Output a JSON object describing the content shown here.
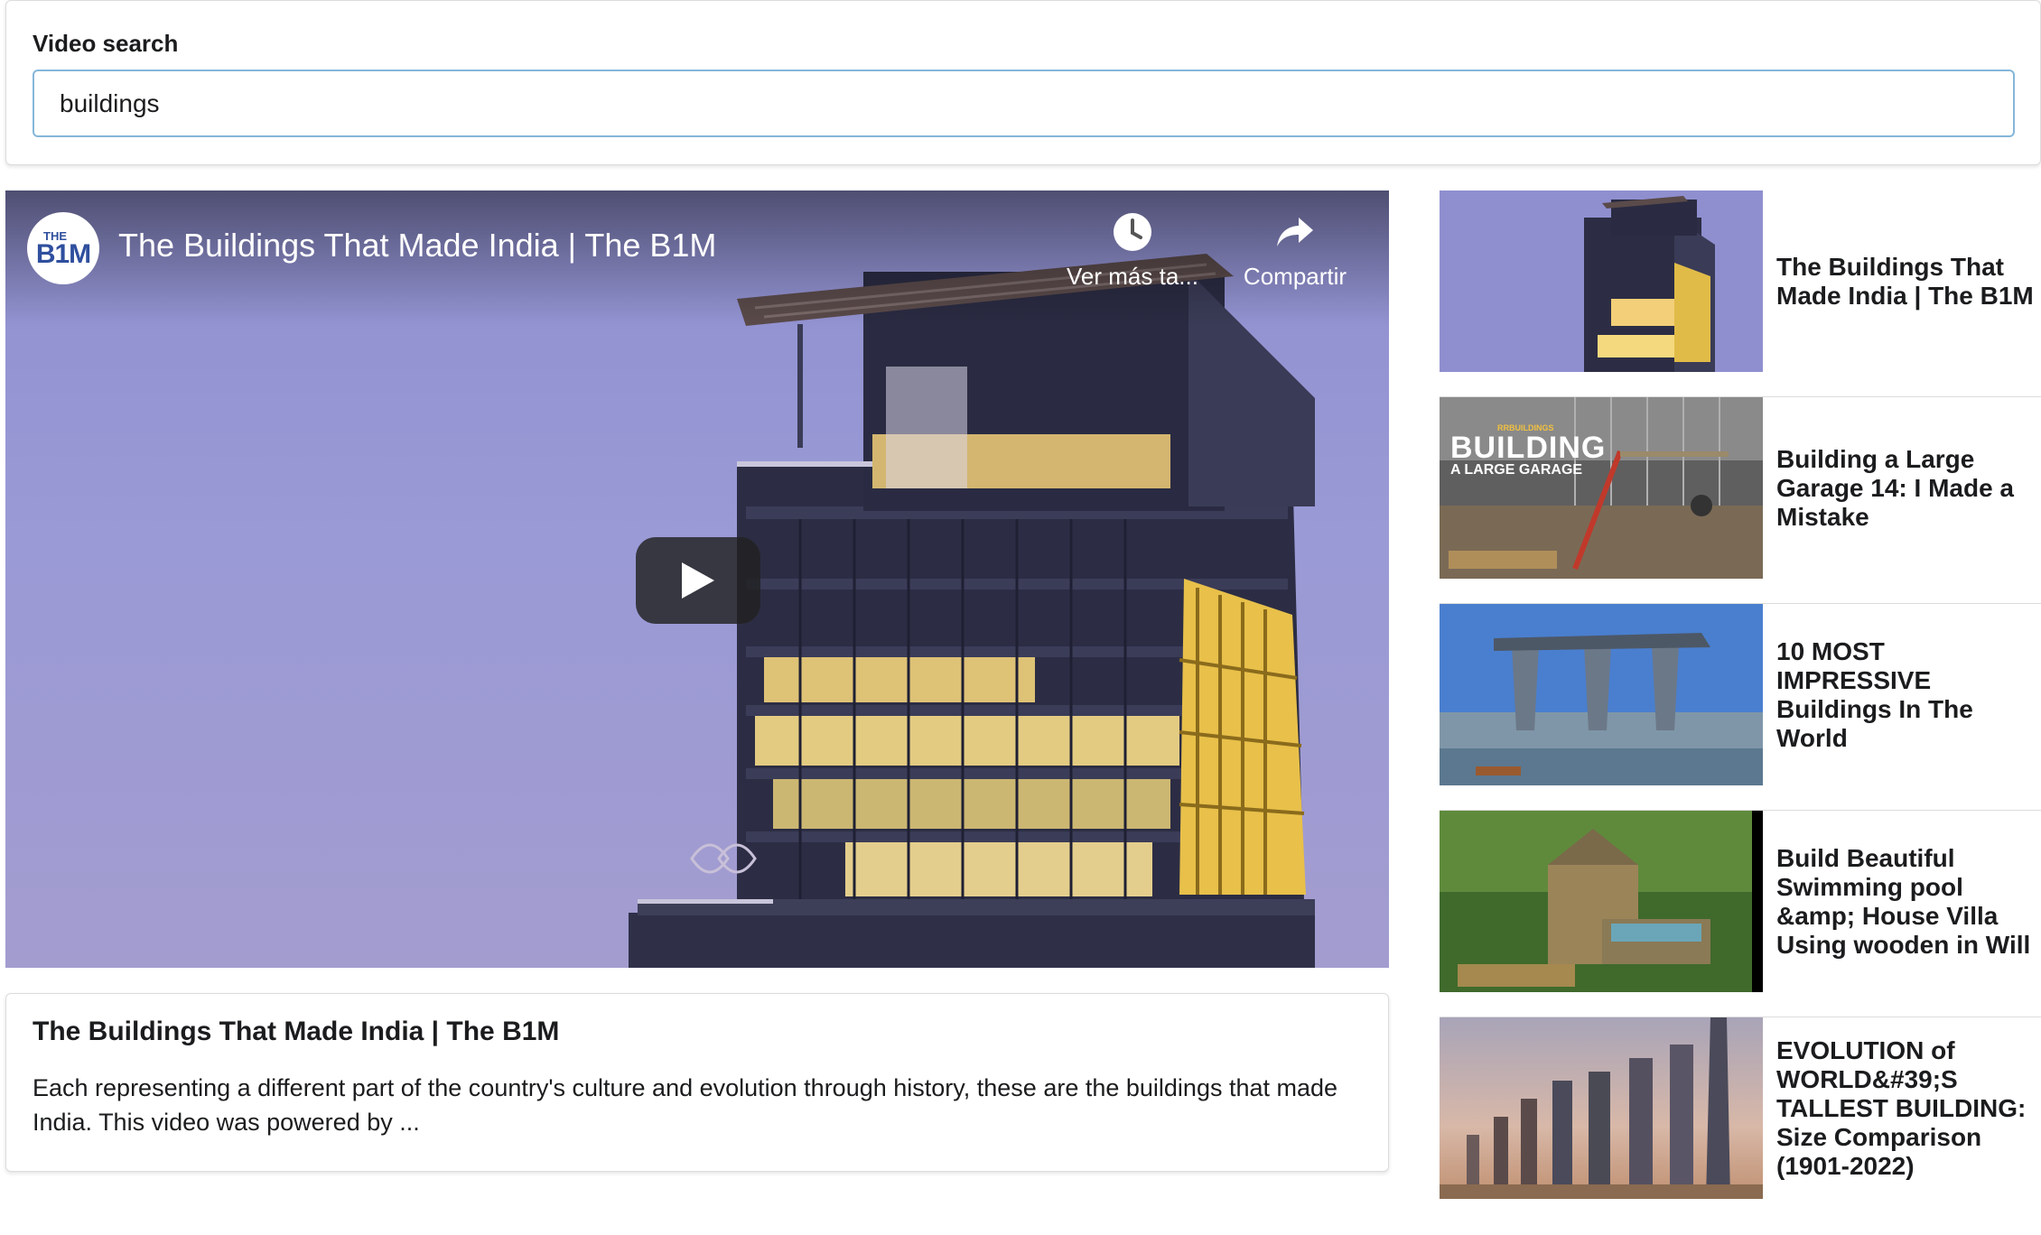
{
  "search": {
    "label": "Video search",
    "value": "buildings"
  },
  "player": {
    "channel_logo_top": "THE",
    "channel_logo_main": "B1M",
    "title": "The Buildings That Made India | The B1M",
    "watch_later_label": "Ver más ta...",
    "share_label": "Compartir",
    "watch_later_icon": "clock-icon",
    "share_icon": "share-arrow-icon",
    "play_icon": "play-icon"
  },
  "selected": {
    "title": "The Buildings That Made India | The B1M",
    "description": "Each representing a different part of the country's culture and evolution through history, these are the buildings that made India. This video was powered by ..."
  },
  "videos": [
    {
      "title": "The Buildings That Made India | The B1M"
    },
    {
      "title": "Building a Large Garage 14: I Made a Mistake",
      "thumb_overlay_small": "RRBUILDINGS",
      "thumb_overlay_big": "BUILDING",
      "thumb_overlay_sub": "A LARGE GARAGE"
    },
    {
      "title": "10 MOST IMPRESSIVE Buildings In The World"
    },
    {
      "title": "Build Beautiful Swimming pool &amp; House Villa Using wooden in Will"
    },
    {
      "title": "EVOLUTION of WORLD&#39;S TALLEST BUILDING: Size Comparison (1901-2022)"
    }
  ],
  "colors": {
    "input_border": "#85b7d9",
    "text": "#1b1c1d",
    "card_border": "#dcdcdd"
  }
}
